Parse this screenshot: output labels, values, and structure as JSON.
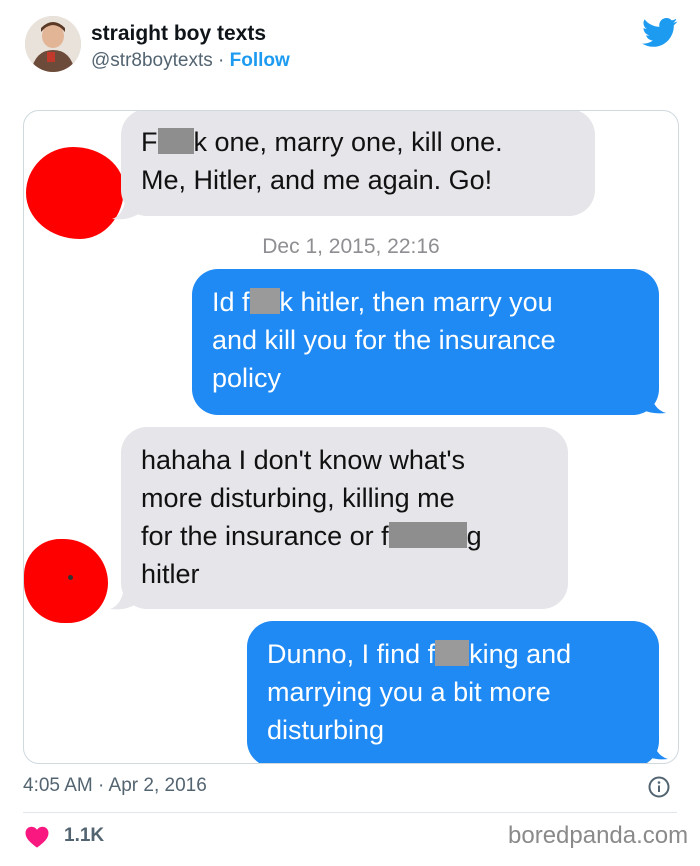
{
  "header": {
    "display_name": "straight boy texts",
    "handle": "@str8boytexts",
    "separator": " · ",
    "follow_label": "Follow"
  },
  "conversation": {
    "msg1_part1": "F",
    "msg1_part2": "k one, marry one, kill one.",
    "msg1_line2": "Me, Hitler, and me again. Go!",
    "timestamp": "Dec 1, 2015, 22:16",
    "msg2_part1": "Id f",
    "msg2_part2": "k hitler, then marry you",
    "msg2_line2": "and kill you for the insurance",
    "msg2_line3": "policy",
    "msg3_line1": "hahaha I don't know what's",
    "msg3_line2": "more disturbing, killing me",
    "msg3_line3_a": "for the insurance or f",
    "msg3_line3_b": "g",
    "msg3_line4": "hitler",
    "msg4_line1_a": "Dunno, I find f",
    "msg4_line1_b": "king and",
    "msg4_line2": "marrying you a bit more",
    "msg4_line3": "disturbing"
  },
  "footer": {
    "time": "4:05 AM · Apr 2, 2016",
    "likes": "1.1K",
    "watermark": "boredpanda.com"
  },
  "colors": {
    "twitter_blue": "#1d9bf0",
    "imessage_blue": "#1f8af4",
    "imessage_gray": "#e5e5ea",
    "like_pink": "#f91880",
    "redaction_red": "#ff0000"
  },
  "icons": [
    "twitter-bird-icon",
    "info-icon",
    "heart-icon"
  ]
}
